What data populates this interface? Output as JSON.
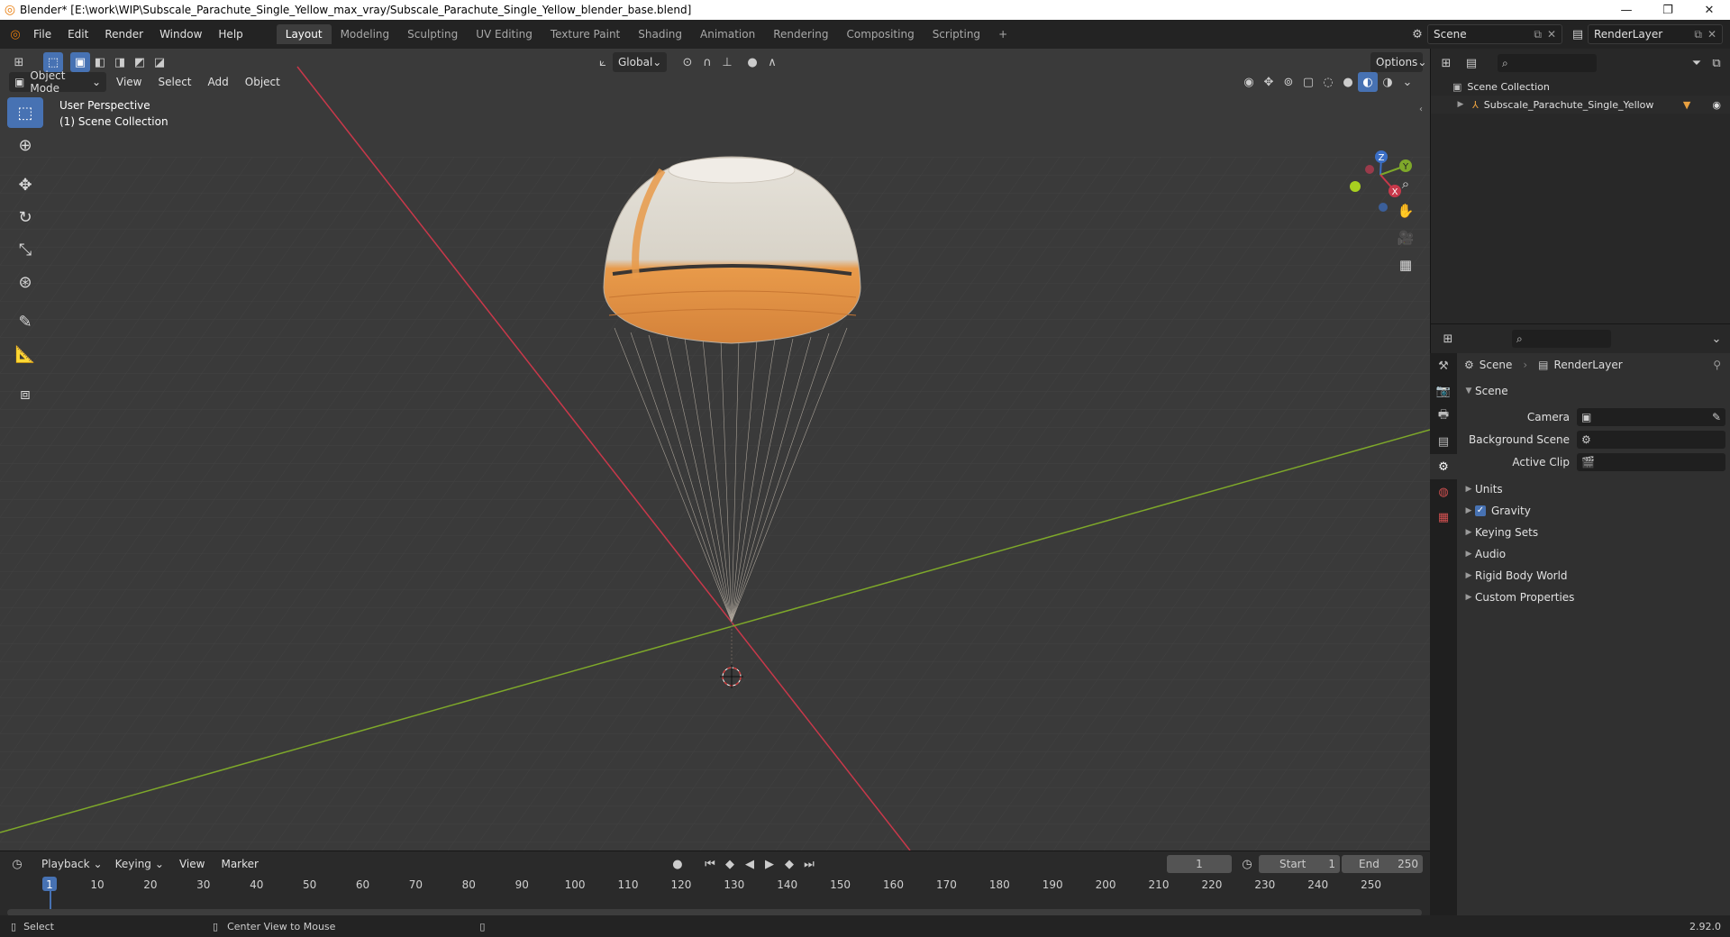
{
  "window": {
    "title": "Blender* [E:\\work\\WIP\\Subscale_Parachute_Single_Yellow_max_vray/Subscale_Parachute_Single_Yellow_blender_base.blend]",
    "minimize": "—",
    "maximize": "❐",
    "close": "✕"
  },
  "menu": [
    "File",
    "Edit",
    "Render",
    "Window",
    "Help"
  ],
  "workspaces": [
    "Layout",
    "Modeling",
    "Sculpting",
    "UV Editing",
    "Texture Paint",
    "Shading",
    "Animation",
    "Rendering",
    "Compositing",
    "Scripting"
  ],
  "workspace_add": "+",
  "scene": {
    "name": "Scene",
    "render_layer": "RenderLayer"
  },
  "viewport": {
    "mode": "Object Mode",
    "header_menus": [
      "View",
      "Select",
      "Add",
      "Object"
    ],
    "transform_orientation": "Global",
    "options": "Options",
    "perspective": "User Perspective",
    "collection": "(1) Scene Collection",
    "gizmo": {
      "z": "Z",
      "y": "Y",
      "x": "X"
    }
  },
  "outliner": {
    "root": "Scene Collection",
    "object": "Subscale_Parachute_Single_Yellow"
  },
  "properties": {
    "breadcrumb_scene": "Scene",
    "breadcrumb_layer": "RenderLayer",
    "panel_title": "Scene",
    "fields": {
      "camera_label": "Camera",
      "background_scene_label": "Background Scene",
      "active_clip_label": "Active Clip"
    },
    "panels": [
      {
        "label": "Units",
        "checkbox": false
      },
      {
        "label": "Gravity",
        "checkbox": true
      },
      {
        "label": "Keying Sets",
        "checkbox": false
      },
      {
        "label": "Audio",
        "checkbox": false
      },
      {
        "label": "Rigid Body World",
        "checkbox": false
      },
      {
        "label": "Custom Properties",
        "checkbox": false
      }
    ]
  },
  "timeline": {
    "menus": [
      "Playback",
      "Keying",
      "View",
      "Marker"
    ],
    "current_frame": "1",
    "start_label": "Start",
    "start": "1",
    "end_label": "End",
    "end": "250",
    "ruler": [
      "1",
      "10",
      "20",
      "30",
      "40",
      "50",
      "60",
      "70",
      "80",
      "90",
      "100",
      "110",
      "120",
      "130",
      "140",
      "150",
      "160",
      "170",
      "180",
      "190",
      "200",
      "210",
      "220",
      "230",
      "240",
      "250"
    ]
  },
  "statusbar": {
    "select": "Select",
    "center_view": "Center View to Mouse",
    "version": "2.92.0"
  },
  "colors": {
    "accent": "#4772b3",
    "x_axis": "#c8384a",
    "y_axis": "#7ea82a",
    "canopy_orange": "#e89a4a",
    "canopy_white": "#e8e4dc"
  }
}
